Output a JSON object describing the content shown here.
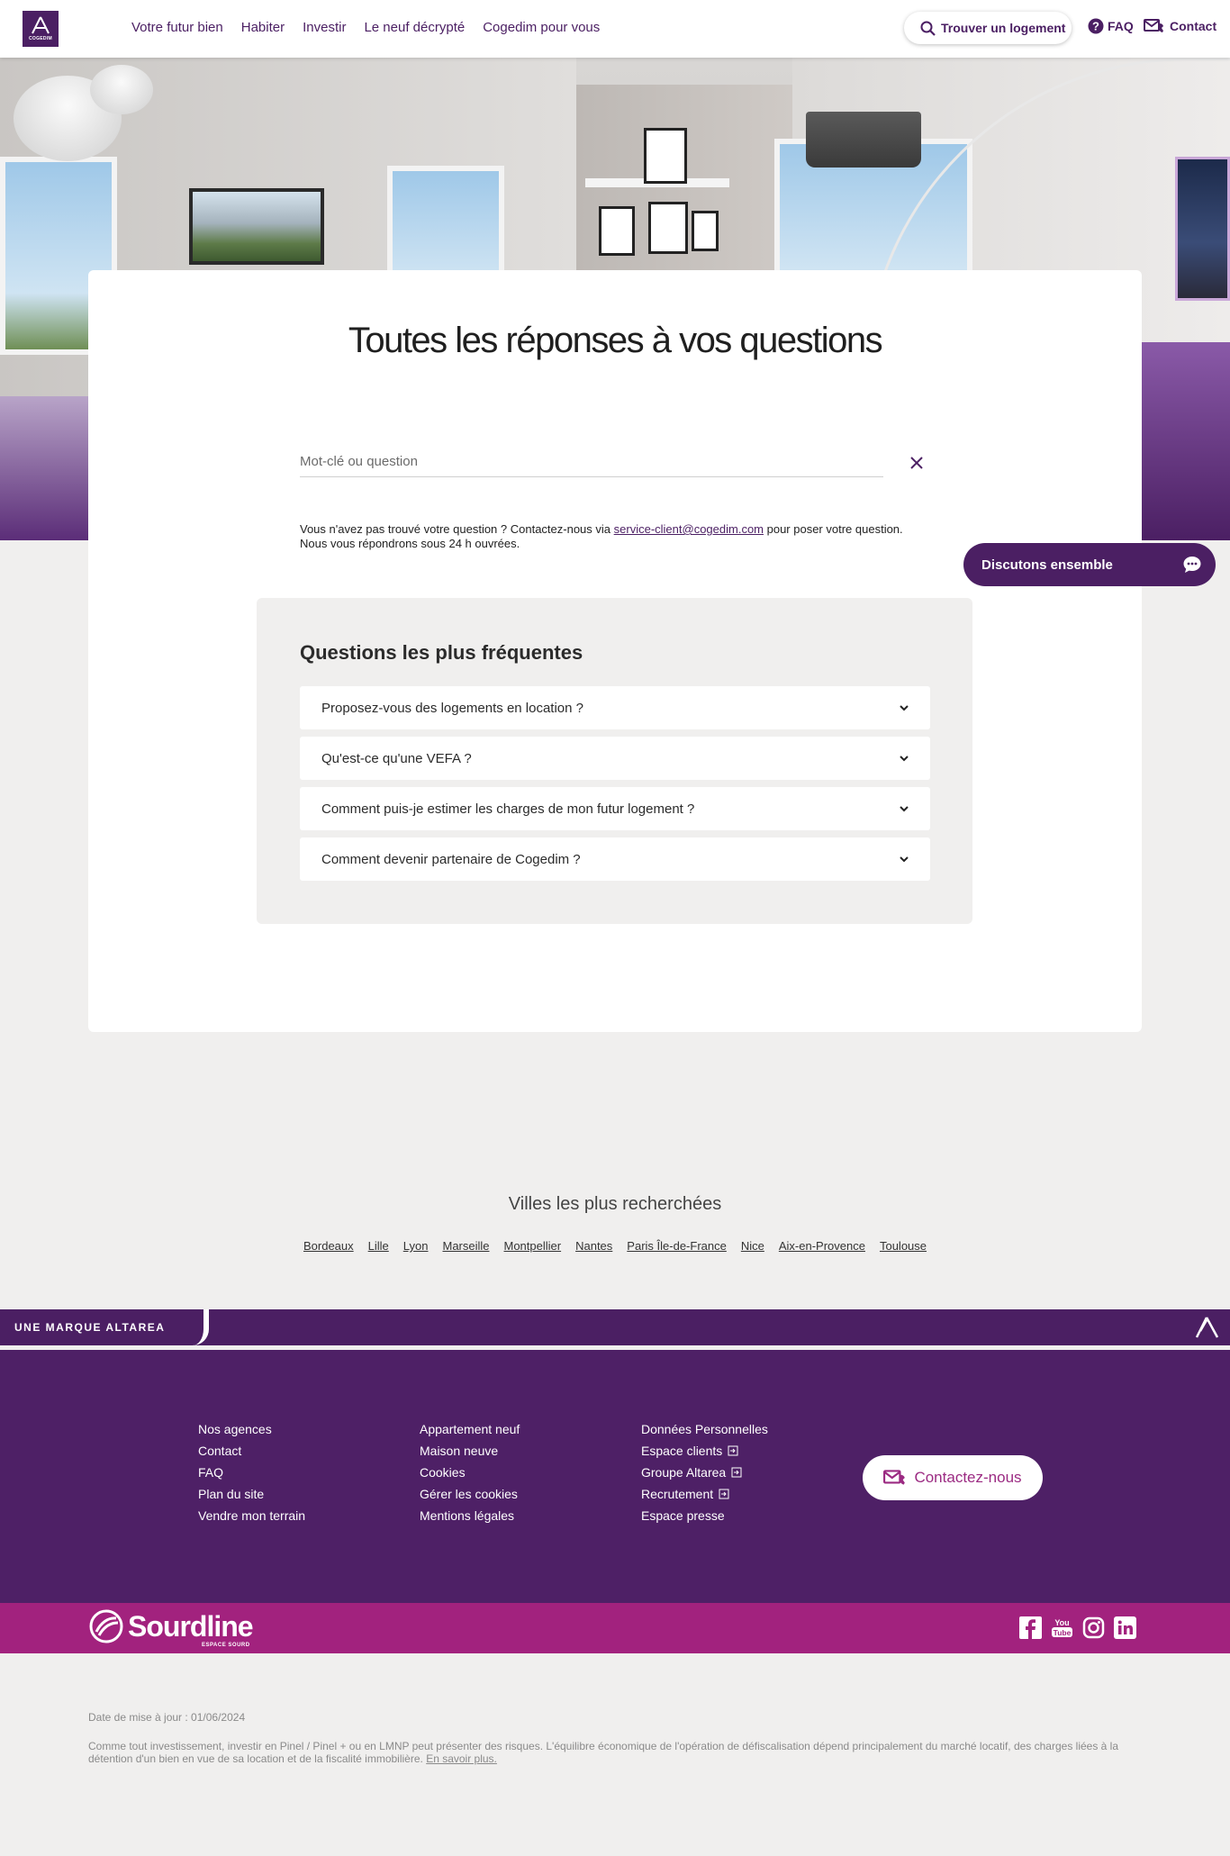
{
  "header": {
    "logo_text": "COGEDIM",
    "nav": [
      "Votre futur bien",
      "Habiter",
      "Investir",
      "Le neuf décrypté",
      "Cogedim pour vous"
    ],
    "search_label": "Trouver un logement",
    "faq_label": "FAQ",
    "contact_label": "Contact"
  },
  "main": {
    "title": "Toutes les réponses à vos questions",
    "search_placeholder": "Mot-clé ou question",
    "help_prefix": "Vous n'avez pas trouvé votre question ? Contactez-nous via ",
    "help_email": "service-client@cogedim.com",
    "help_suffix": " pour poser votre question. Nous vous répondrons sous 24 h ouvrées.",
    "faq_title": "Questions les plus fréquentes",
    "faq_items": [
      "Proposez-vous des logements en location ?",
      "Qu'est-ce qu'une VEFA ?",
      "Comment puis-je estimer les charges de mon futur logement ?",
      "Comment devenir partenaire de Cogedim ?"
    ]
  },
  "chat": {
    "label": "Discutons ensemble"
  },
  "cities": {
    "title": "Villes les plus recherchées",
    "items": [
      "Bordeaux",
      "Lille",
      "Lyon",
      "Marseille",
      "Montpellier",
      "Nantes",
      "Paris Île-de-France",
      "Nice",
      "Aix-en-Provence",
      "Toulouse"
    ]
  },
  "footer": {
    "brand_tag": "UNE MARQUE ALTAREA",
    "col1": [
      "Nos agences",
      "Contact",
      "FAQ",
      "Plan du site",
      "Vendre mon terrain"
    ],
    "col2": [
      "Appartement neuf",
      "Maison neuve",
      "Cookies",
      "Gérer les cookies",
      "Mentions légales"
    ],
    "col3": [
      "Données Personnelles",
      "Espace clients",
      "Groupe Altarea",
      "Recrutement",
      "Espace presse"
    ],
    "contact_button": "Contactez-nous",
    "sourdline_name": "Sourdline",
    "sourdline_sub": "ESPACE SOURD",
    "socials": [
      "facebook-icon",
      "youtube-icon",
      "instagram-icon",
      "linkedin-icon"
    ]
  },
  "legal": {
    "date": "Date de mise à jour : 01/06/2024",
    "text": "Comme tout investissement, investir en Pinel / Pinel + ou en LMNP peut présenter des risques. L'équilibre économique de l'opération de défiscalisation dépend principalement du marché locatif, des charges liées à la détention d'un bien en vue de sa location et de la fiscalité immobilière. ",
    "link": "En savoir plus."
  },
  "colors": {
    "brand_purple": "#4b1f63",
    "accent_magenta": "#a2227e",
    "background": "#f0efee"
  }
}
